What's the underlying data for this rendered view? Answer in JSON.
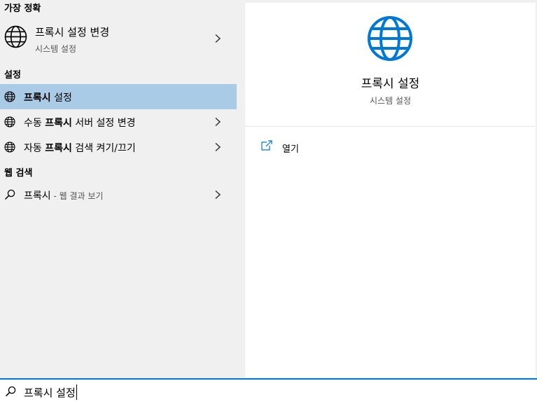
{
  "left": {
    "best_match_header": "가장 정확",
    "best_match": {
      "title": "프록시 설정 변경",
      "subtitle": "시스템 설정",
      "icon": "globe-icon"
    },
    "settings_header": "설정",
    "settings_items": [
      {
        "bold": "프록시",
        "after": " 설정",
        "icon": "globe-icon",
        "selected": true
      },
      {
        "before": "수동 ",
        "bold": "프록시",
        "after": " 서버 설정 변경",
        "icon": "globe-icon"
      },
      {
        "before": "자동 ",
        "bold": "프록시",
        "after": " 검색 켜기/끄기",
        "icon": "globe-icon"
      }
    ],
    "web_header": "웹 검색",
    "web_item": {
      "query": "프록시",
      "suffix": " - 웹 결과 보기",
      "icon": "search-icon"
    }
  },
  "right": {
    "title": "프록시 설정",
    "subtitle": "시스템 설정",
    "icon": "globe-icon",
    "action_label": "열기",
    "action_icon": "open-external-icon"
  },
  "search": {
    "value": "프록시 설정",
    "icon": "search-icon"
  },
  "colors": {
    "accent": "#0078d7",
    "selected_bg": "#a9cbe6",
    "left_bg": "#f0f0f0",
    "right_bg": "#ffffff"
  }
}
